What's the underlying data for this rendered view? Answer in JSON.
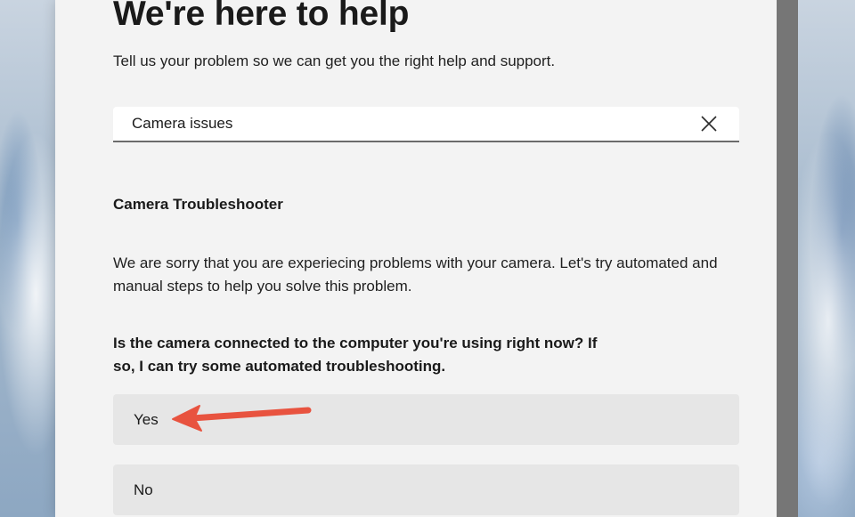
{
  "page": {
    "title": "We're here to help",
    "subtitle": "Tell us your problem so we can get you the right help and support."
  },
  "search": {
    "value": "Camera issues",
    "clear_icon": "close-icon"
  },
  "troubleshooter": {
    "title": "Camera Troubleshooter",
    "description": "We are sorry that you are experiecing problems with your camera. Let's try automated and manual steps to help you solve this problem.",
    "question": "Is the camera connected to the computer you're using right now? If so, I can try some automated troubleshooting.",
    "options": [
      {
        "label": "Yes"
      },
      {
        "label": "No"
      }
    ]
  },
  "annotation": {
    "icon": "red-arrow-icon",
    "color": "#e8533f"
  }
}
